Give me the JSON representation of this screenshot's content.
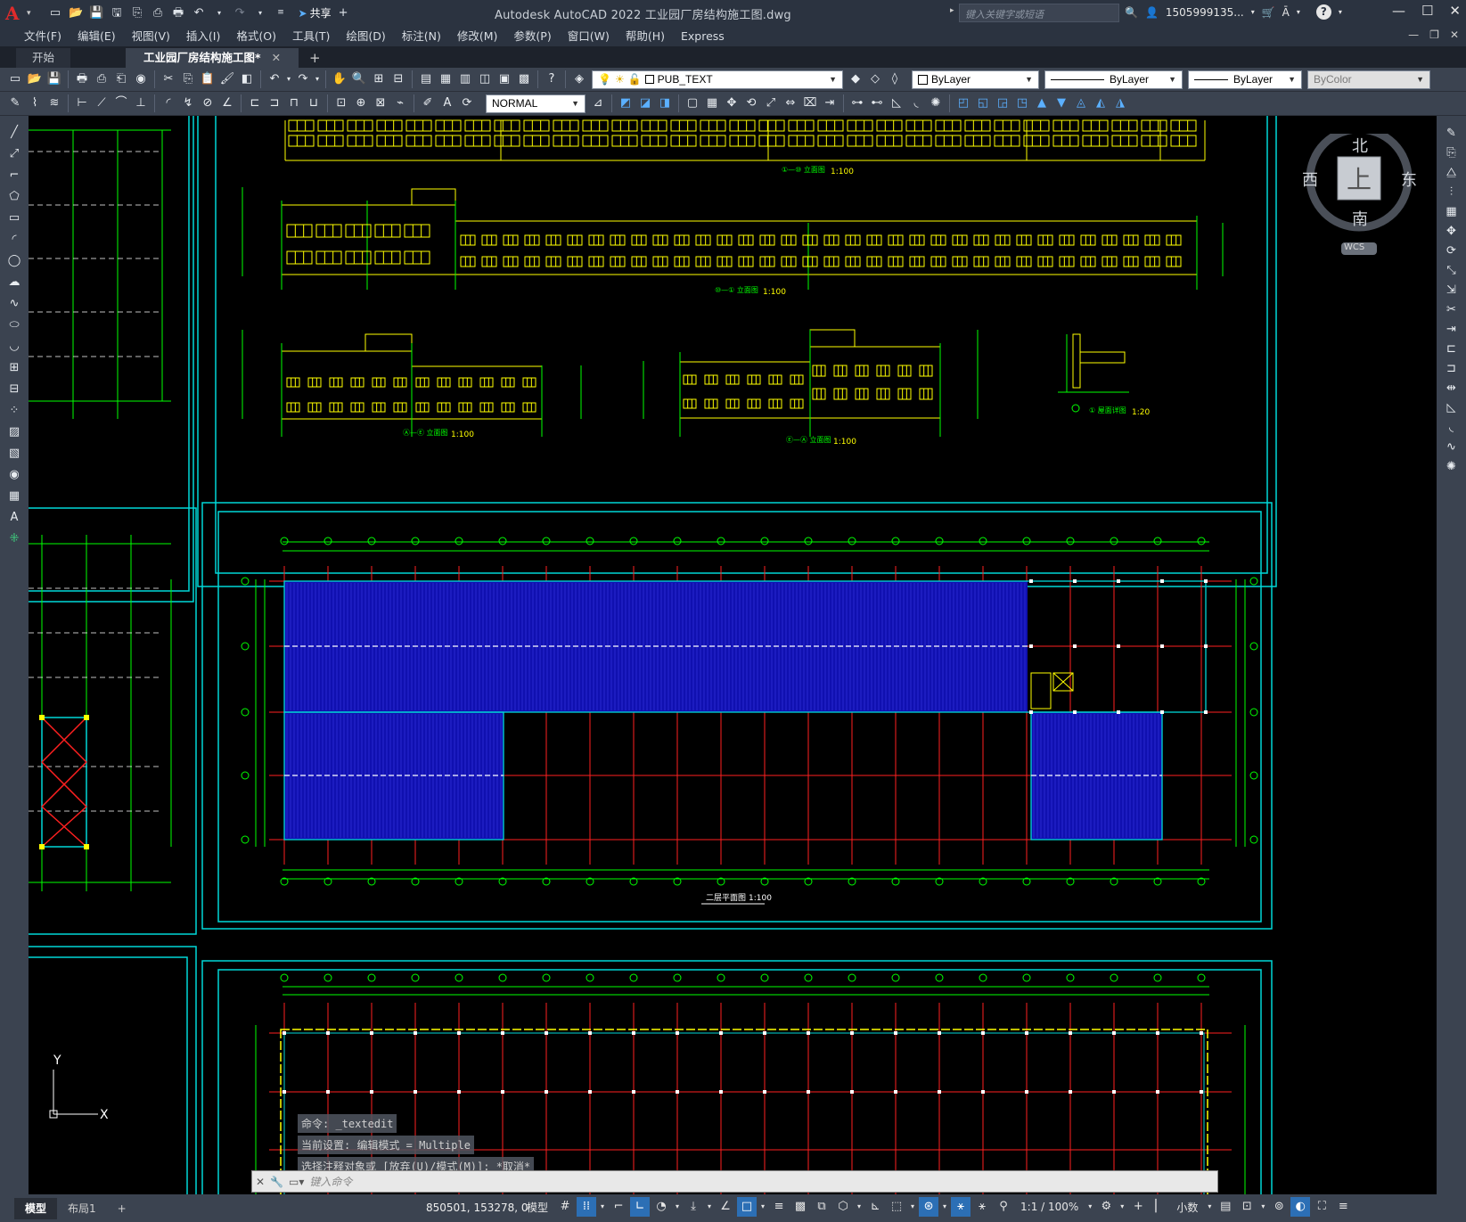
{
  "app": {
    "logo": "A",
    "title": "Autodesk AutoCAD 2022    工业园厂房结构施工图.dwg",
    "share_label": "共享",
    "search_placeholder": "键入关键字或短语",
    "user": "1505999135...",
    "window_buttons": [
      "—",
      "☐",
      "✕"
    ]
  },
  "menu": {
    "items": [
      "文件(F)",
      "编辑(E)",
      "视图(V)",
      "插入(I)",
      "格式(O)",
      "工具(T)",
      "绘图(D)",
      "标注(N)",
      "修改(M)",
      "参数(P)",
      "窗口(W)",
      "帮助(H)",
      "Express"
    ]
  },
  "tabs": {
    "start": "开始",
    "active": "工业园厂房结构施工图*",
    "close": "✕",
    "new": "+"
  },
  "toolbar": {
    "layer_name": "PUB_TEXT",
    "color": "ByLayer",
    "linetype": "ByLayer",
    "lineweight": "ByLayer",
    "plotstyle": "ByColor",
    "textstyle": "NORMAL"
  },
  "viewcube": {
    "north": "北",
    "south": "南",
    "east": "东",
    "west": "西",
    "top": "上",
    "wcs": "WCS"
  },
  "drawing": {
    "elev1_label": "①—⑩ 立面图",
    "elev1_scale": "1:100",
    "elev2_label": "⑩—① 立面图",
    "elev2_scale": "1:100",
    "elev3_label": "Ⓐ—Ⓔ 立面图",
    "elev3_scale": "1:100",
    "elev4_label": "Ⓔ—Ⓐ 立面图",
    "elev4_scale": "1:100",
    "detail_label": "① 屋面详图",
    "detail_scale": "1:20",
    "plan_label": "二层平面图",
    "plan_scale": "1:100",
    "ucs_y": "Y",
    "ucs_x": "X"
  },
  "command": {
    "history": [
      "命令: _textedit",
      "当前设置: 编辑模式 = Multiple",
      "选择注释对象或 [放弃(U)/模式(M)]: *取消*"
    ],
    "placeholder": "键入命令"
  },
  "status": {
    "model_tab": "模型",
    "layout_tab": "布局1",
    "add_tab": "+",
    "coords": "850501, 153278, 0",
    "model_label": "模型",
    "scale": "1:1 / 100%",
    "units": "小数"
  },
  "colors": {
    "frame": "#00d8d8",
    "elevation_lines": "#ffff00",
    "dim_lines": "#00ff00",
    "grid_red": "#ff2020",
    "hatch_blue": "#1010b0",
    "accent": "#2c6fb5"
  }
}
